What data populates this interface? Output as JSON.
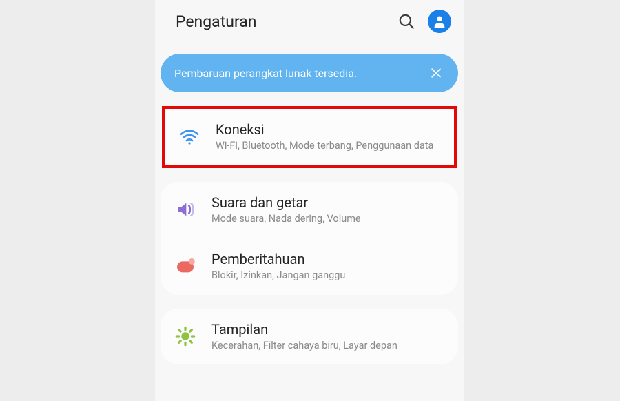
{
  "header": {
    "title": "Pengaturan"
  },
  "banner": {
    "text": "Pembaruan perangkat lunak tersedia."
  },
  "items": {
    "connections": {
      "title": "Koneksi",
      "subtitle": "Wi-Fi, Bluetooth, Mode terbang, Penggunaan data"
    },
    "sound": {
      "title": "Suara dan getar",
      "subtitle": "Mode suara, Nada dering, Volume"
    },
    "notifications": {
      "title": "Pemberitahuan",
      "subtitle": "Blokir, Izinkan, Jangan ganggu"
    },
    "display": {
      "title": "Tampilan",
      "subtitle": "Kecerahan, Filter cahaya biru, Layar depan"
    }
  },
  "colors": {
    "accent_blue": "#1b80e8",
    "banner_blue": "#62b4f0",
    "highlight_red": "#e30909"
  }
}
